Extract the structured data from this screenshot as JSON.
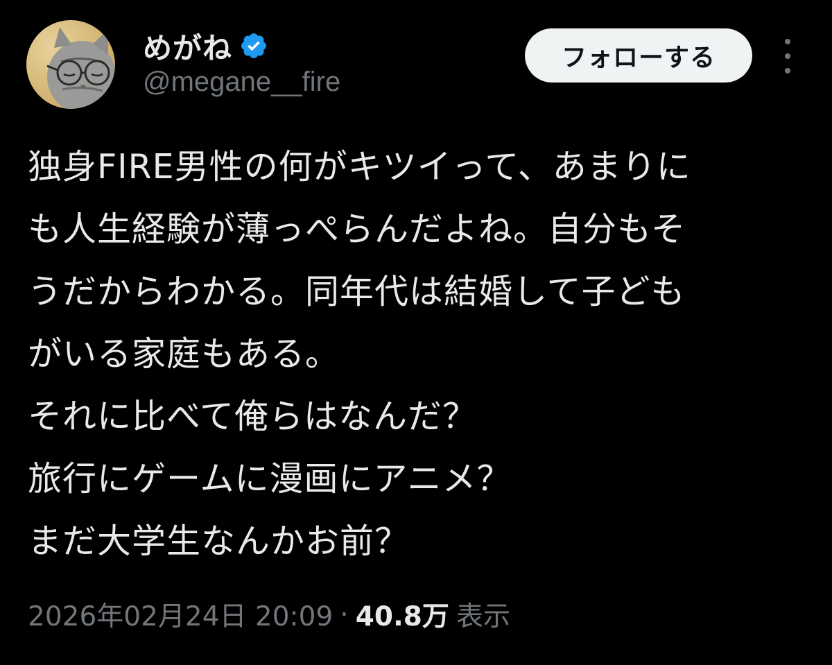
{
  "user": {
    "display_name": "めがね",
    "handle": "@megane__fire",
    "verified": true
  },
  "actions": {
    "follow_label": "フォローする",
    "more_icon": "more-vertical-icon"
  },
  "tweet": {
    "lines": [
      "独身FIRE男性の何がキツイって、あまりに",
      "も人生経験が薄っぺらんだよね。自分もそ",
      "うだからわかる。同年代は結婚して子ども",
      "がいる家庭もある。",
      "それに比べて俺らはなんだ？",
      "旅行にゲームに漫画にアニメ？",
      "まだ大学生なんかお前？"
    ]
  },
  "meta": {
    "timestamp": "2026年02月24日 20:09",
    "separator": "·",
    "views_count": "40.8万",
    "views_label": "表示"
  },
  "colors": {
    "background": "#000000",
    "text": "#e7e9ea",
    "secondary_text": "#71767b",
    "verified_blue": "#1d9bf0",
    "follow_button_bg": "#eff3f4"
  }
}
